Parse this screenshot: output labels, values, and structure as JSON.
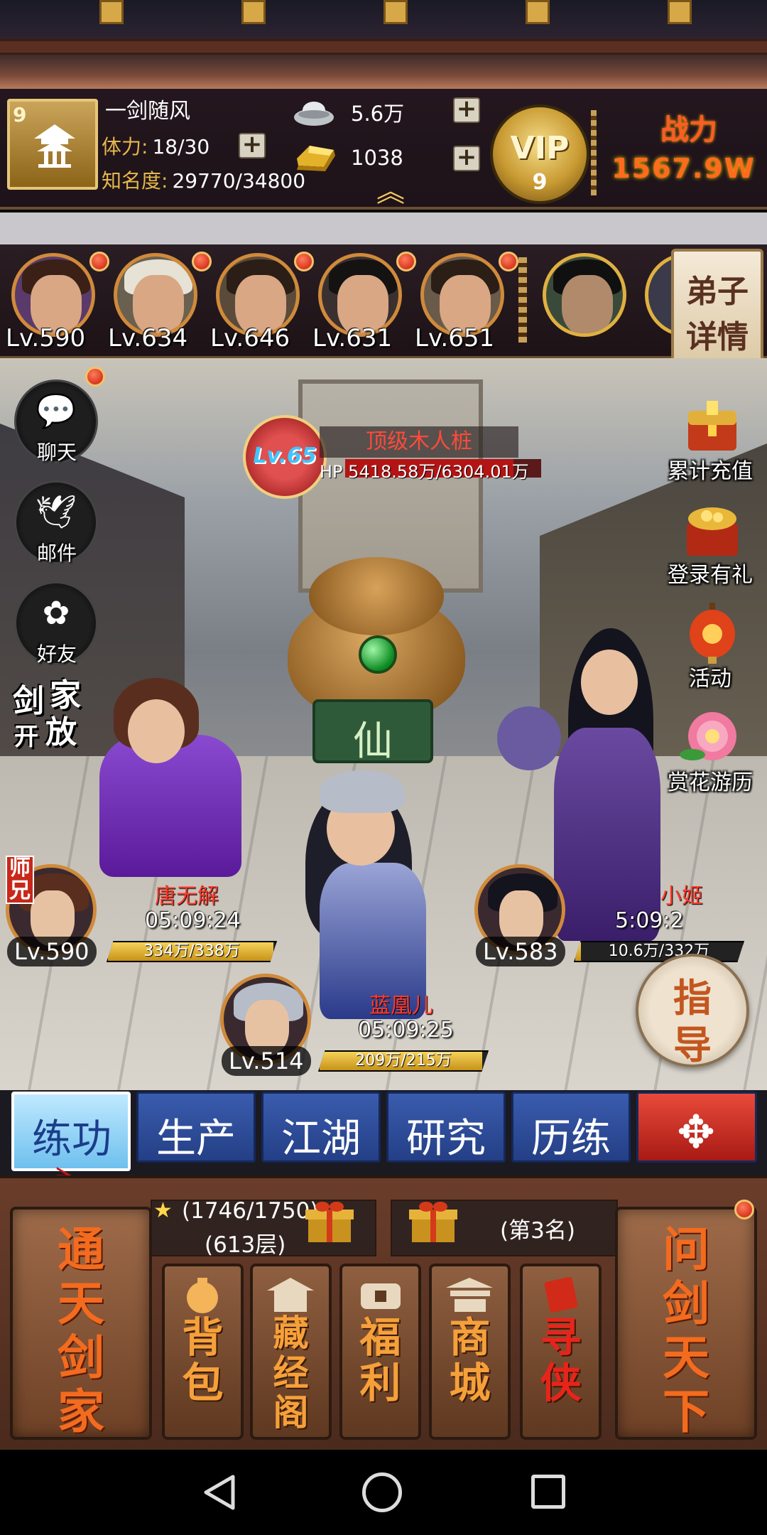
{
  "header": {
    "player_level": "9",
    "player_name": "一剑随风",
    "stamina_label": "体力:",
    "stamina_value": "18/30",
    "fame_label": "知名度:",
    "fame_value": "29770/34800",
    "silver_value": "5.6万",
    "gold_value": "1038",
    "vip_label": "VIP",
    "vip_level": "9",
    "power_label": "战力",
    "power_value": "1567.9W"
  },
  "disciples": {
    "items": [
      {
        "level": "Lv.590"
      },
      {
        "level": "Lv.634"
      },
      {
        "level": "Lv.646"
      },
      {
        "level": "Lv.631"
      },
      {
        "level": "Lv.651"
      }
    ],
    "detail_button": [
      "弟子",
      "详情"
    ]
  },
  "side_buttons": [
    {
      "label": "聊天",
      "icon": "chat-icon"
    },
    {
      "label": "邮件",
      "icon": "dove-icon"
    },
    {
      "label": "好友",
      "icon": "friends-icon"
    }
  ],
  "jianjia_badge": [
    "剑",
    "家",
    "开",
    "放"
  ],
  "events": [
    {
      "label": "累计充值",
      "icon": "treasure-chest-icon"
    },
    {
      "label": "登录有礼",
      "icon": "gift-chest-icon"
    },
    {
      "label": "活动",
      "icon": "lantern-icon"
    },
    {
      "label": "赏花游历",
      "icon": "flower-icon"
    }
  ],
  "boss": {
    "level": "Lv.65",
    "name": "顶级木人桩",
    "hp_label": "HP",
    "hp_text": "5418.58万/6304.01万",
    "hp_current": 5418.58,
    "hp_max": 6304.01
  },
  "statue_plaque": "仙",
  "units": [
    {
      "name": "唐无解",
      "level": "Lv.590",
      "time": "05:09:24",
      "hp_text": "334万/338万",
      "hp_current": 334,
      "hp_max": 338,
      "tag": "师兄"
    },
    {
      "name": "蓝凰儿",
      "level": "Lv.514",
      "time": "05:09:25",
      "hp_text": "209万/215万",
      "hp_current": 209,
      "hp_max": 215
    },
    {
      "name": "小姬",
      "level": "Lv.583",
      "time": "5:09:2",
      "hp_text": "10.6万/332万",
      "hp_current": 10.6,
      "hp_max": 332
    }
  ],
  "guide_button": [
    "指",
    "导"
  ],
  "tabs": [
    {
      "label": "练功",
      "active": true
    },
    {
      "label": "生产"
    },
    {
      "label": "江湖"
    },
    {
      "label": "研究"
    },
    {
      "label": "历练"
    },
    {
      "label": "✥"
    }
  ],
  "bottom": {
    "left_plaque": [
      "通",
      "天",
      "剑",
      "家"
    ],
    "right_plaque": [
      "问",
      "剑",
      "天",
      "下"
    ],
    "tower_progress": "(1746/1750)",
    "tower_floor": "(613层)",
    "rank_text": "(第3名)",
    "buttons": [
      {
        "label": [
          "背",
          "包"
        ],
        "icon": "bag-icon"
      },
      {
        "label": [
          "藏",
          "经",
          "阁"
        ],
        "icon": "pavilion-icon"
      },
      {
        "label": [
          "福",
          "利"
        ],
        "icon": "coin-icon"
      },
      {
        "label": [
          "商",
          "城"
        ],
        "icon": "shop-icon"
      },
      {
        "label": [
          "寻",
          "侠"
        ],
        "icon": "seal-icon"
      }
    ]
  },
  "colors": {
    "tab_blue": "#2f4f9e",
    "tab_active": "#8fd2f4",
    "plaque_text": "#f36b1e",
    "boss_name": "#ff4a3a",
    "power_text": "#ff6b1e"
  }
}
